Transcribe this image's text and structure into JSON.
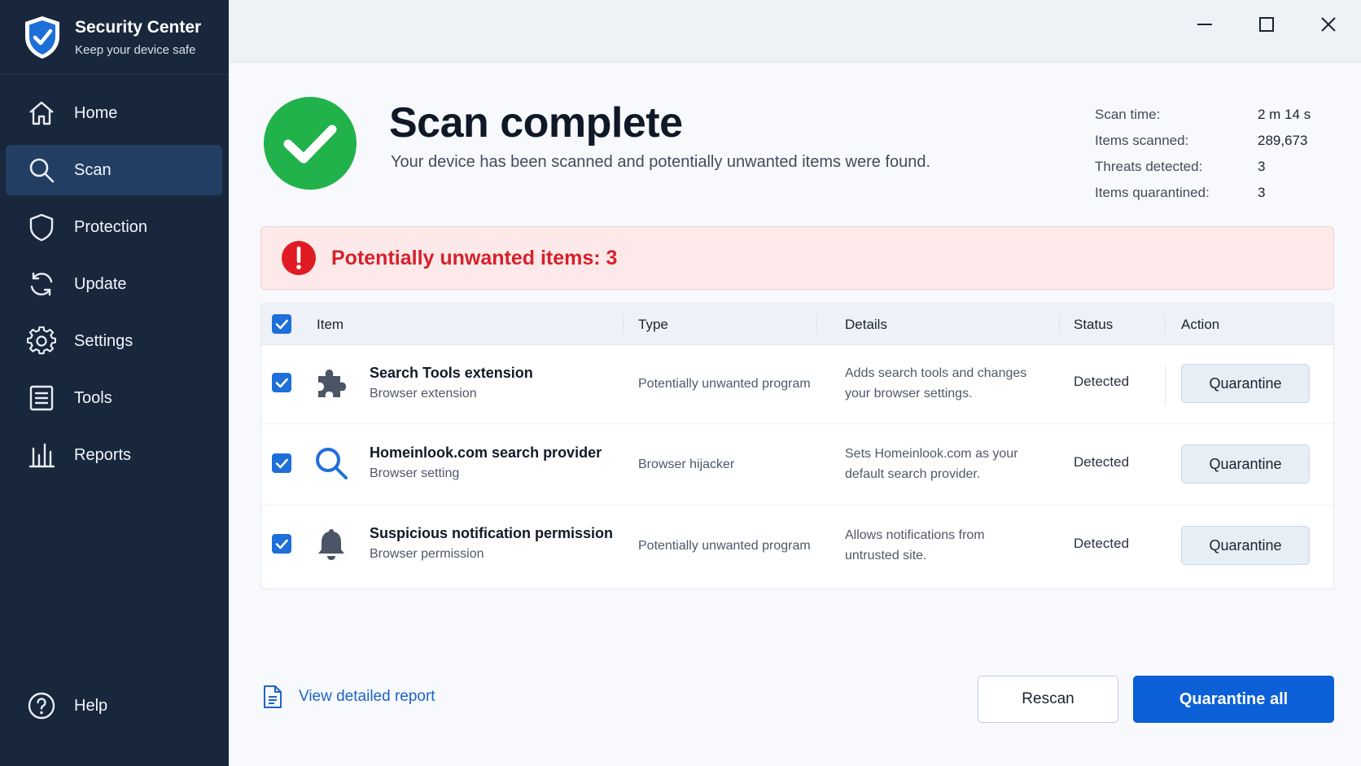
{
  "app": {
    "title": "Security Center",
    "subtitle": "Keep your device safe"
  },
  "sidebar": {
    "items": [
      {
        "label": "Home",
        "icon": "home-icon"
      },
      {
        "label": "Scan",
        "icon": "search-icon",
        "active": true
      },
      {
        "label": "Protection",
        "icon": "shield-icon"
      },
      {
        "label": "Update",
        "icon": "refresh-icon"
      },
      {
        "label": "Settings",
        "icon": "gear-icon"
      },
      {
        "label": "Tools",
        "icon": "list-icon"
      },
      {
        "label": "Reports",
        "icon": "bar-chart-icon"
      }
    ],
    "help": {
      "label": "Help",
      "icon": "help-icon"
    }
  },
  "header": {
    "title": "Scan complete",
    "subtitle": "Your device has been scanned and potentially unwanted items were found."
  },
  "stats": [
    {
      "label": "Scan time:",
      "value": "2 m 14 s"
    },
    {
      "label": "Items scanned:",
      "value": "289,673"
    },
    {
      "label": "Threats detected:",
      "value": "3"
    },
    {
      "label": "Items quarantined:",
      "value": "3"
    }
  ],
  "alert": {
    "text": "Potentially unwanted items: 3"
  },
  "table": {
    "headers": {
      "item": "Item",
      "type": "Type",
      "details": "Details",
      "status": "Status",
      "action": "Action"
    },
    "rows": [
      {
        "name": "Search Tools extension",
        "sub": "Browser extension",
        "type": "Potentially unwanted program",
        "details": "Adds search tools and changes your browser settings.",
        "status": "Detected",
        "action": "Quarantine",
        "icon": "puzzle-icon"
      },
      {
        "name": "Homeinlook.com search provider",
        "sub": "Browser setting",
        "type": "Browser hijacker",
        "details": "Sets Homeinlook.com as your default search provider.",
        "status": "Detected",
        "action": "Quarantine",
        "icon": "search-icon"
      },
      {
        "name": "Suspicious notification permission",
        "sub": "Browser permission",
        "type": "Potentially unwanted program",
        "details": "Allows notifications from untrusted site.",
        "status": "Detected",
        "action": "Quarantine",
        "icon": "bell-icon"
      }
    ]
  },
  "footer": {
    "report_link": "View detailed report",
    "rescan": "Rescan",
    "quarantine_all": "Quarantine all"
  },
  "colors": {
    "sidebar_bg": "#18273c",
    "accent": "#0b5fd7",
    "success": "#22b24c",
    "danger": "#d7202a"
  }
}
